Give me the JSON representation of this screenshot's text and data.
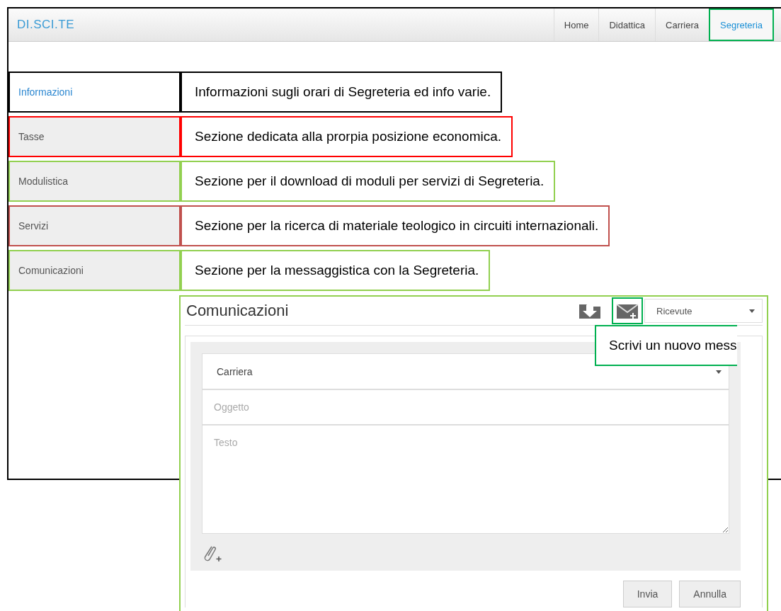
{
  "navbar": {
    "brand": "DI.SCI.TE",
    "items": [
      {
        "label": "Home",
        "selected": false
      },
      {
        "label": "Didattica",
        "selected": false
      },
      {
        "label": "Carriera",
        "selected": false
      },
      {
        "label": "Segreteria",
        "selected": true
      }
    ]
  },
  "sidebar": {
    "items": [
      {
        "label": "Informazioni",
        "selected": true,
        "note": "Informazioni sugli orari di Segreteria ed info varie.",
        "color": "#000000"
      },
      {
        "label": "Tasse",
        "selected": false,
        "note": "Sezione dedicata alla prorpia posizione economica.",
        "color": "#ff0000"
      },
      {
        "label": "Modulistica",
        "selected": false,
        "note": "Sezione per il download di moduli per servizi di Segreteria.",
        "color": "#92d050"
      },
      {
        "label": "Servizi",
        "selected": false,
        "note": "Sezione per la ricerca di materiale teologico in circuiti internazionali.",
        "color": "#c0504d"
      },
      {
        "label": "Comunicazioni",
        "selected": false,
        "note": "Sezione per la messaggistica con la Segreteria.",
        "color": "#92d050"
      }
    ]
  },
  "messages_panel": {
    "title": "Comunicazioni",
    "folder_select": "Ricevute",
    "category_select": "Carriera",
    "subject_placeholder": "Oggetto",
    "body_placeholder": "Testo",
    "buttons": [
      "Invia",
      "Annulla"
    ]
  },
  "new_message_note": {
    "text": "Scrivi un nuovo mess",
    "color": "#00b050"
  }
}
